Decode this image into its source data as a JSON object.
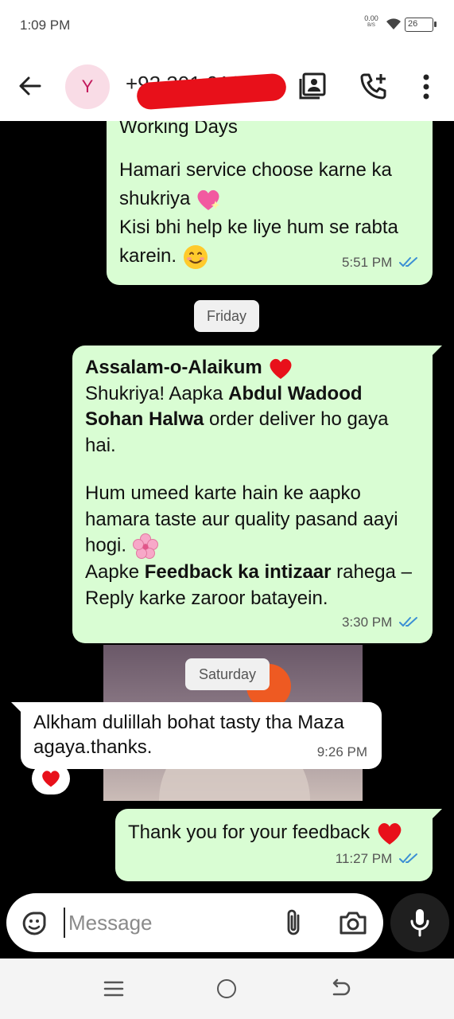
{
  "status_bar": {
    "time": "1:09 PM",
    "net_speed": "0.00",
    "net_unit": "B/S",
    "battery": "26",
    "icons": [
      "wifi-icon",
      "battery-icon"
    ]
  },
  "header": {
    "avatar_letter": "Y",
    "contact_number": "+92 301 01353",
    "icons": [
      "back-arrow-icon",
      "contact-card-icon",
      "add-call-icon",
      "more-vert-icon"
    ]
  },
  "colors": {
    "outgoing_bubble": "#d9fdd3",
    "incoming_bubble": "#ffffff",
    "read_ticks": "#3b8fd4",
    "chat_background": "#000000"
  },
  "messages": {
    "m1": {
      "line0": "Working Days",
      "line1": "Hamari service choose karne ka",
      "line2": "shukriya",
      "line3": "Kisi bhi help ke liye hum se rabta",
      "line4": "karein.",
      "time": "5:51 PM"
    },
    "date_friday": "Friday",
    "m2": {
      "greeting": "Assalam-o-Alaikum",
      "p1_a": "Shukriya! Aapka ",
      "p1_bold1": "Abdul Wadood",
      "p1_bold2": "Sohan Halwa",
      "p1_b": " order deliver ho gaya",
      "p1_c": "hai.",
      "p2_a": "Hum umeed karte hain ke aapko",
      "p2_b": "hamara taste aur quality pasand aayi",
      "p2_c": "hogi.",
      "p3_a": "Aapke ",
      "p3_bold": "Feedback ka intizaar",
      "p3_b": " rahega –",
      "p3_c": "Reply karke zaroor batayein.",
      "time": "3:30 PM"
    },
    "date_saturday": "Saturday",
    "m3": {
      "line1": "Alkham dulillah bohat tasty tha Maza",
      "line2": "agaya.thanks.",
      "time": "9:26 PM",
      "reaction": "red-heart"
    },
    "m4": {
      "text": "Thank you for your feedback",
      "time": "11:27 PM"
    }
  },
  "composer": {
    "placeholder": "Message",
    "icons": [
      "sticker-icon",
      "attach-icon",
      "camera-icon",
      "mic-icon"
    ]
  },
  "nav_bar": {
    "icons": [
      "recents-icon",
      "home-icon",
      "back-icon"
    ]
  }
}
